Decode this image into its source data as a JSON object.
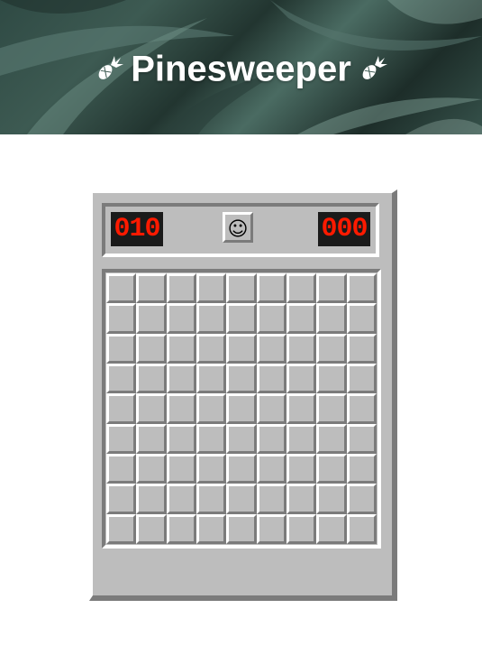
{
  "header": {
    "title": "Pinesweeper",
    "icon": "pineapple-icon"
  },
  "game": {
    "mines_remaining": "010",
    "timer": "000",
    "face": "☺",
    "rows": 9,
    "cols": 9,
    "cell_state": "unrevealed"
  },
  "colors": {
    "counter_text": "#ff1a00",
    "counter_bg": "#1a1a1a",
    "panel": "#bdbdbd",
    "bevel_light": "#ffffff",
    "bevel_dark": "#7b7b7b"
  }
}
